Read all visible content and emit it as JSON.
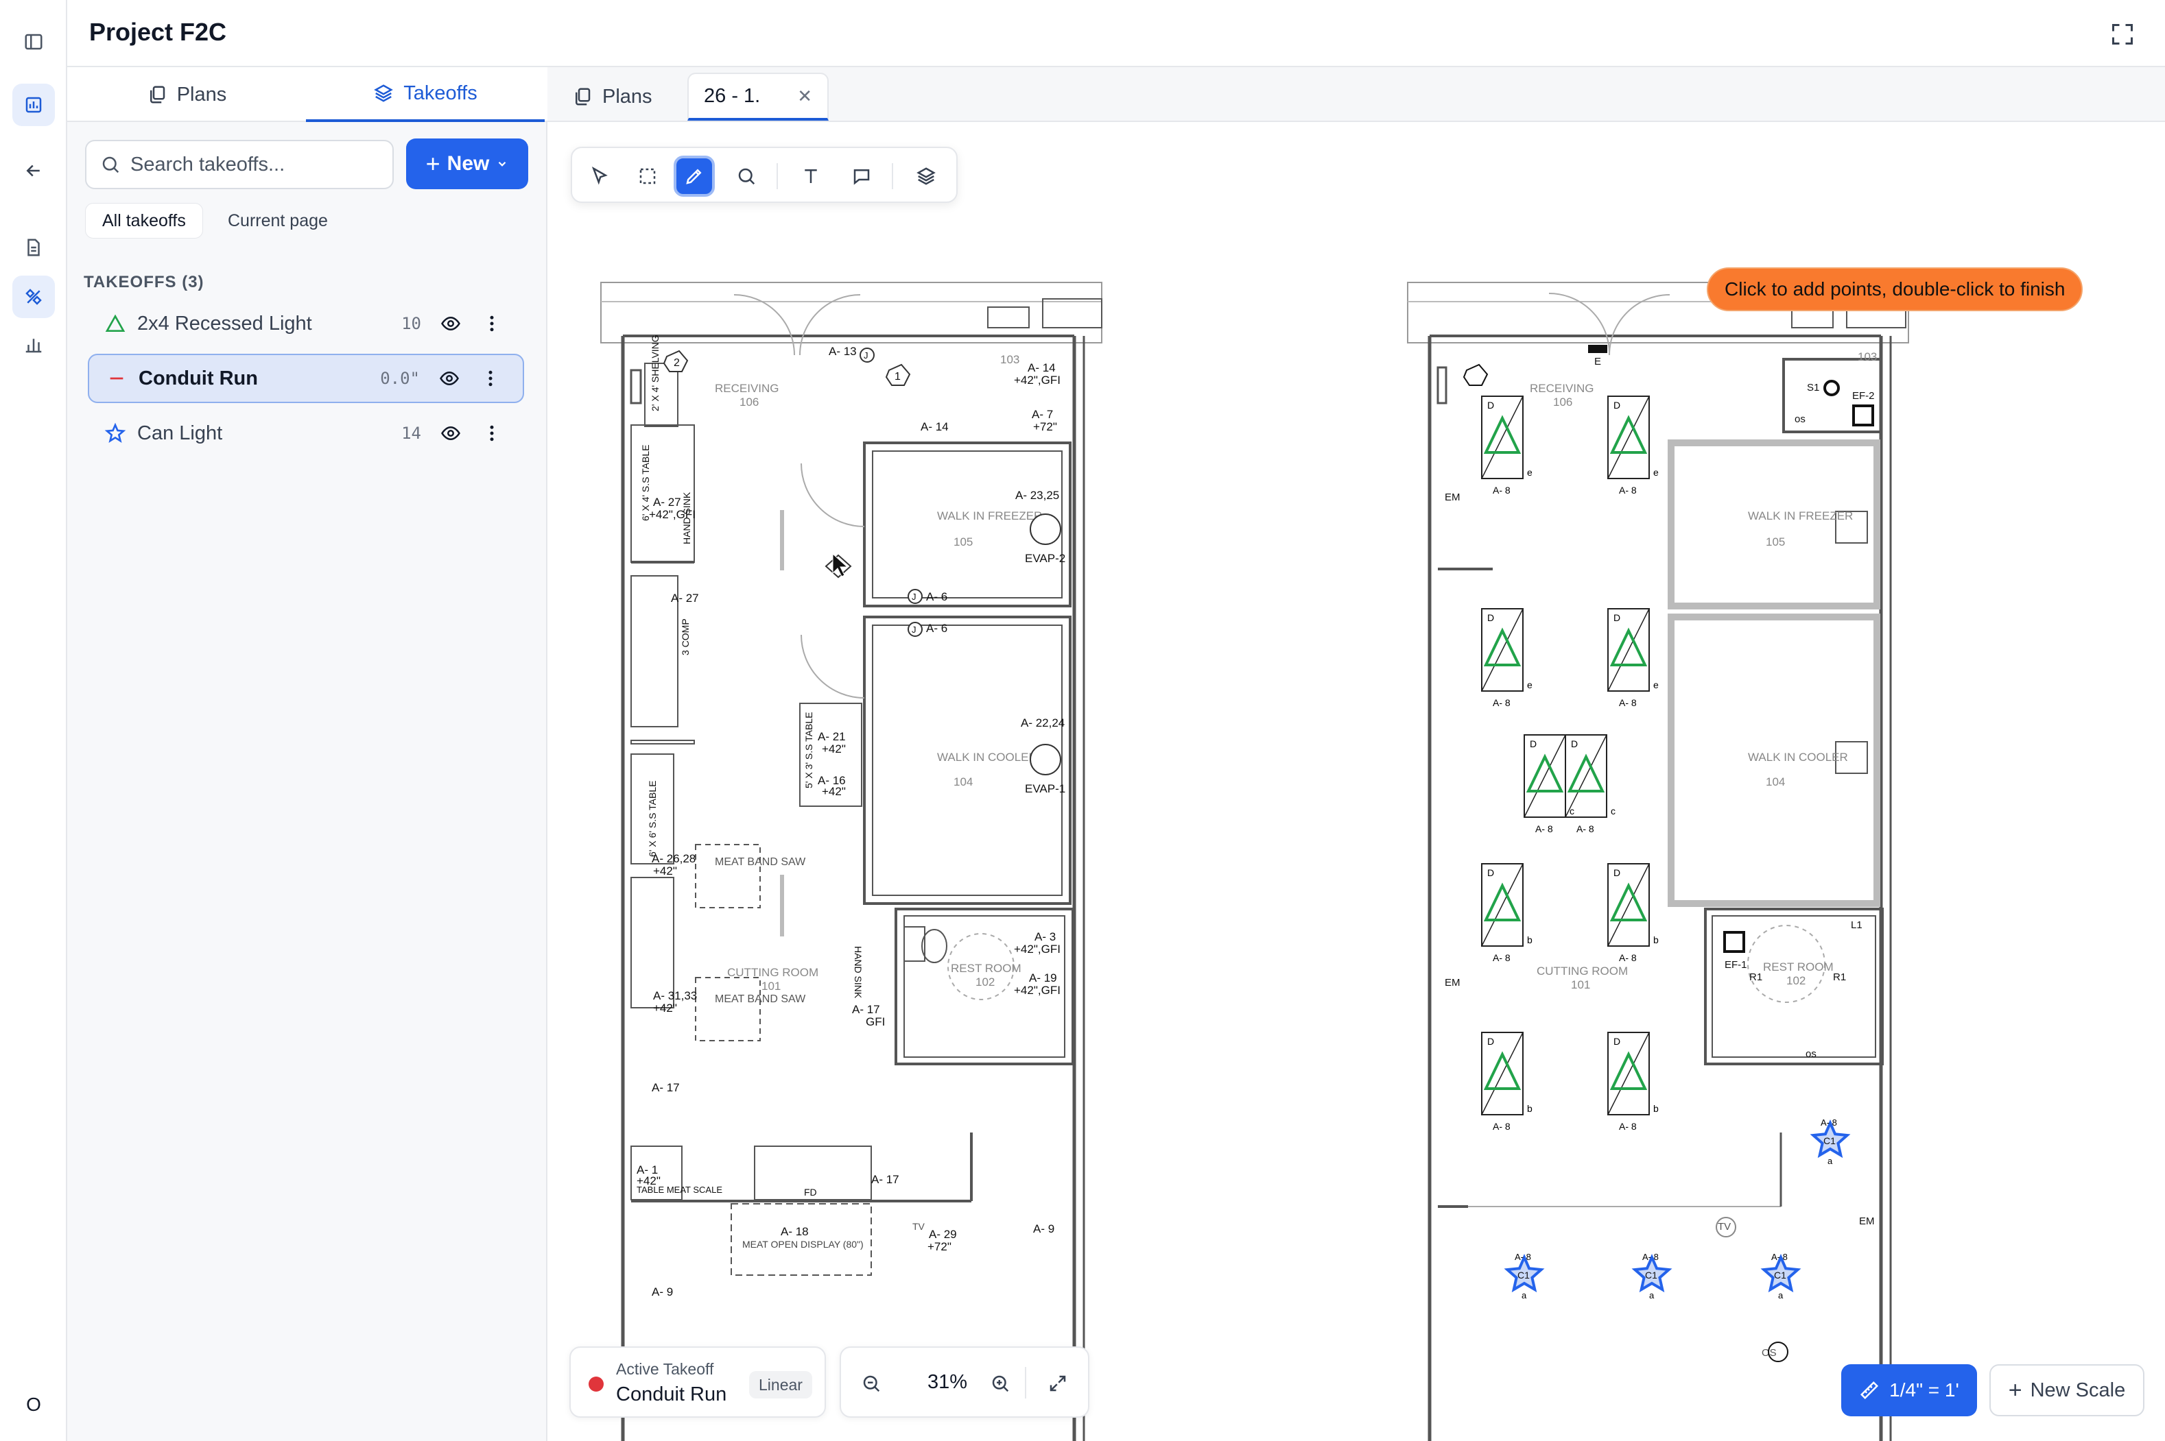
{
  "app": {
    "project_title": "Project F2C",
    "user_initial": "O"
  },
  "rail": {
    "items": [
      "sidebar-toggle-icon",
      "dashboard-icon",
      "back-arrow-icon",
      "document-icon",
      "takeoff-tools-icon",
      "chart-icon"
    ],
    "active": "dashboard-icon"
  },
  "panel": {
    "tabs": [
      {
        "label": "Plans",
        "icon": "plans-icon"
      },
      {
        "label": "Takeoffs",
        "icon": "layers-icon",
        "active": true
      }
    ],
    "search": {
      "placeholder": "Search takeoffs..."
    },
    "new_button": "New",
    "filters": [
      "All takeoffs",
      "Current page"
    ],
    "active_filter": "All takeoffs",
    "takeoffs_header": "TAKEOFFS (3)",
    "takeoffs": [
      {
        "name": "2x4 Recessed Light",
        "count": "10",
        "shape": "triangle",
        "color": "#22a34a"
      },
      {
        "name": "Conduit Run",
        "count": "0.0\"",
        "shape": "line",
        "color": "#e0353b",
        "selected": true
      },
      {
        "name": "Can Light",
        "count": "14",
        "shape": "star",
        "color": "#2463eb"
      }
    ]
  },
  "doc_tabs": [
    {
      "label": "Plans",
      "icon": "plans-icon"
    },
    {
      "label": "26 - 1.",
      "closable": true,
      "active": true
    }
  ],
  "toolbar": {
    "tools": [
      "select-icon",
      "marquee-icon",
      "pen-icon",
      "zoom-icon",
      "text-icon",
      "comment-icon",
      "layers-icon"
    ],
    "active_tool": "pen-icon"
  },
  "hint": "Click to add points, double-click to finish",
  "active_takeoff": {
    "label": "Active Takeoff",
    "name": "Conduit Run",
    "mode": "Linear",
    "dot_color": "#e0353b"
  },
  "zoom": {
    "value": "31%"
  },
  "scale": {
    "current": "1/4\" = 1'",
    "new_label": "New Scale"
  },
  "plans": {
    "left": {
      "rooms": [
        {
          "name": "RECEIVING",
          "number": "106"
        },
        {
          "name": "WALK IN FREEZER",
          "number": "105"
        },
        {
          "name": "WALK IN COOLER",
          "number": "104"
        },
        {
          "name": "CUTTING ROOM",
          "number": "101"
        },
        {
          "name": "REST ROOM",
          "number": "102"
        },
        {
          "number": "103"
        }
      ],
      "fixtures": [
        "2' X 4' SHELVING",
        "6' X 4' S.S TABLE",
        "HAND SINK",
        "3 COMP",
        "5' X 3' S.S TABLE",
        "6' X 6' S.S TABLE",
        "MEAT BAND SAW",
        "MEAT BAND SAW",
        "HAND SINK",
        "TABLE MEAT SCALE",
        "MEAT OPEN DISPLAY (80\")",
        "EVAP-2",
        "EVAP-1",
        "FD",
        "TV",
        "GFI"
      ],
      "circuits": [
        "A- 13",
        "A- 14",
        "A- 14",
        "+42\",GFI",
        "A- 7",
        "+72\"",
        "A- 27",
        "+42\",GFI",
        "A- 23,25",
        "A- 27",
        "A- 6",
        "A- 6",
        "A- 22,24",
        "A- 21",
        "+42\"",
        "A- 16",
        "+42\"",
        "A- 26,28",
        "+42\"",
        "A- 3",
        "+42\",GFI",
        "A- 19",
        "+42\",GFI",
        "A- 31,33",
        "+42\"",
        "A- 17",
        "A- 17",
        "A- 1",
        "+42\"",
        "A- 17",
        "A- 18",
        "A- 29",
        "+72\"",
        "A- 9",
        "A- 9"
      ],
      "tags": [
        "1",
        "2",
        "J",
        "J",
        "J"
      ]
    },
    "right": {
      "rooms": [
        {
          "name": "RECEIVING",
          "number": "106"
        },
        {
          "name": "WALK IN FREEZER",
          "number": "105"
        },
        {
          "name": "WALK IN COOLER",
          "number": "104"
        },
        {
          "name": "CUTTING ROOM",
          "number": "101"
        },
        {
          "name": "REST ROOM",
          "number": "102"
        },
        {
          "number": "103"
        }
      ],
      "fixture_tags": [
        "D",
        "A- 8",
        "e",
        "b",
        "c",
        "EM",
        "E",
        "S1",
        "EF-2",
        "EF-1",
        "R1",
        "L1",
        "os",
        "OS",
        "TV",
        "C1",
        "a"
      ]
    }
  }
}
